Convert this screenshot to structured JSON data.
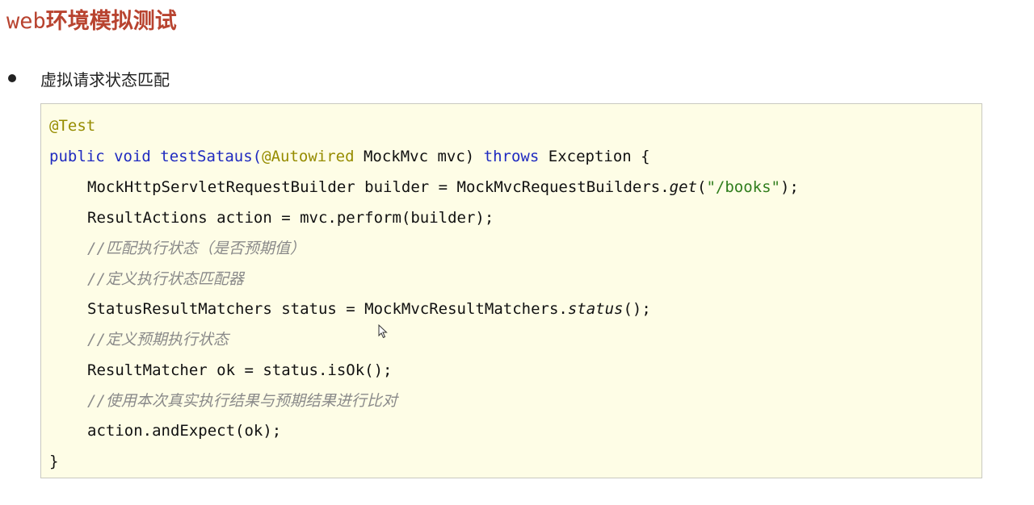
{
  "title": {
    "prefix": "web",
    "rest": "环境模拟测试"
  },
  "bullet": {
    "text": "虚拟请求状态匹配"
  },
  "code": {
    "annotation": "@Test",
    "sig_kw1": "public void ",
    "sig_method": "testSataus(",
    "sig_ann": "@Autowired",
    "sig_param": " MockMvc mvc) ",
    "sig_throws": "throws",
    "sig_end": " Exception {",
    "l3_a": "MockHttpServletRequestBuilder builder = MockMvcRequestBuilders.",
    "l3_get": "get",
    "l3_paren": "(",
    "l3_str": "\"/books\"",
    "l3_end": ");",
    "l4": "ResultActions action = mvc.perform(builder);",
    "c1": "//匹配执行状态（是否预期值）",
    "c2": "//定义执行状态匹配器",
    "l7_a": "StatusResultMatchers status = MockMvcResultMatchers.",
    "l7_status": "status",
    "l7_end": "();",
    "c3": "//定义预期执行状态",
    "l9": "ResultMatcher ok = status.isOk();",
    "c4": "//使用本次真实执行结果与预期结果进行比对",
    "l11": "action.andExpect(ok);",
    "close": "}"
  },
  "icons": {
    "cursor": "mouse-pointer-icon",
    "bullet": "bullet-dot-icon"
  }
}
